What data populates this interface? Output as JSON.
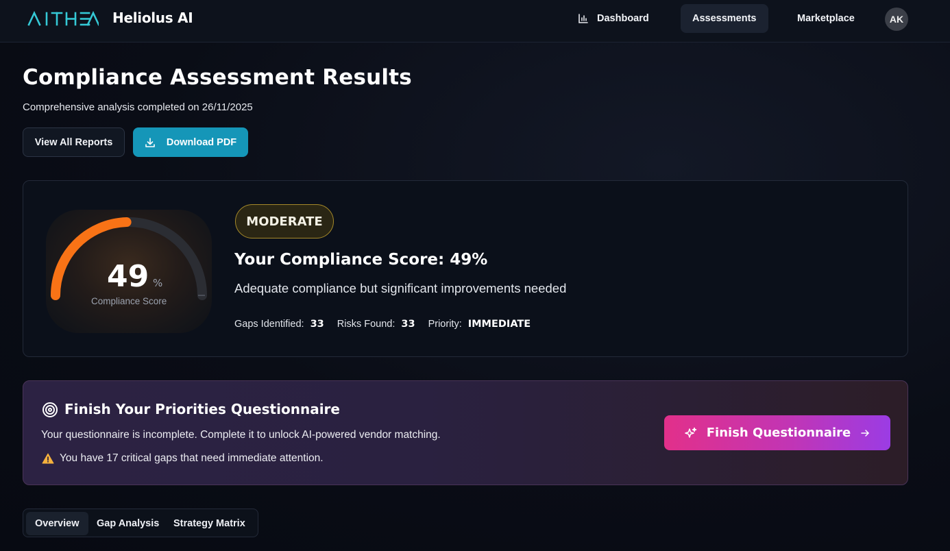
{
  "topbar": {
    "logo_text": "AITHEA",
    "brand": "Heliolus AI",
    "nav": [
      {
        "label": "Dashboard",
        "icon": "bar-chart-icon"
      },
      {
        "label": "Assessments",
        "active": true
      },
      {
        "label": "Marketplace"
      }
    ],
    "avatar_initials": "AK"
  },
  "header": {
    "title": "Compliance Assessment Results",
    "subtitle": "Comprehensive analysis completed on 26/11/2025",
    "view_reports_label": "View All Reports",
    "download_label": "Download PDF"
  },
  "score": {
    "value": 49,
    "value_text": "49",
    "percent_sign": "%",
    "label": "Compliance Score",
    "badge": "MODERATE",
    "title": "Your Compliance Score: 49%",
    "description": "Adequate compliance but significant improvements needed",
    "gaps_label": "Gaps Identified:",
    "gaps_value": "33",
    "risks_label": "Risks Found:",
    "risks_value": "33",
    "priority_label": "Priority:",
    "priority_value": "IMMEDIATE",
    "colors": {
      "arc": "#f97316",
      "track": "#2b2d33",
      "badge_border": "#a68a2a"
    }
  },
  "questionnaire": {
    "title": "Finish Your Priorities Questionnaire",
    "text": "Your questionnaire is incomplete. Complete it to unlock AI-powered vendor matching.",
    "warning": "You have 17 critical gaps that need immediate attention.",
    "button_label": "Finish Questionnaire"
  },
  "tabs": {
    "overview": "Overview",
    "gap": "Gap Analysis",
    "strategy": "Strategy Matrix"
  }
}
